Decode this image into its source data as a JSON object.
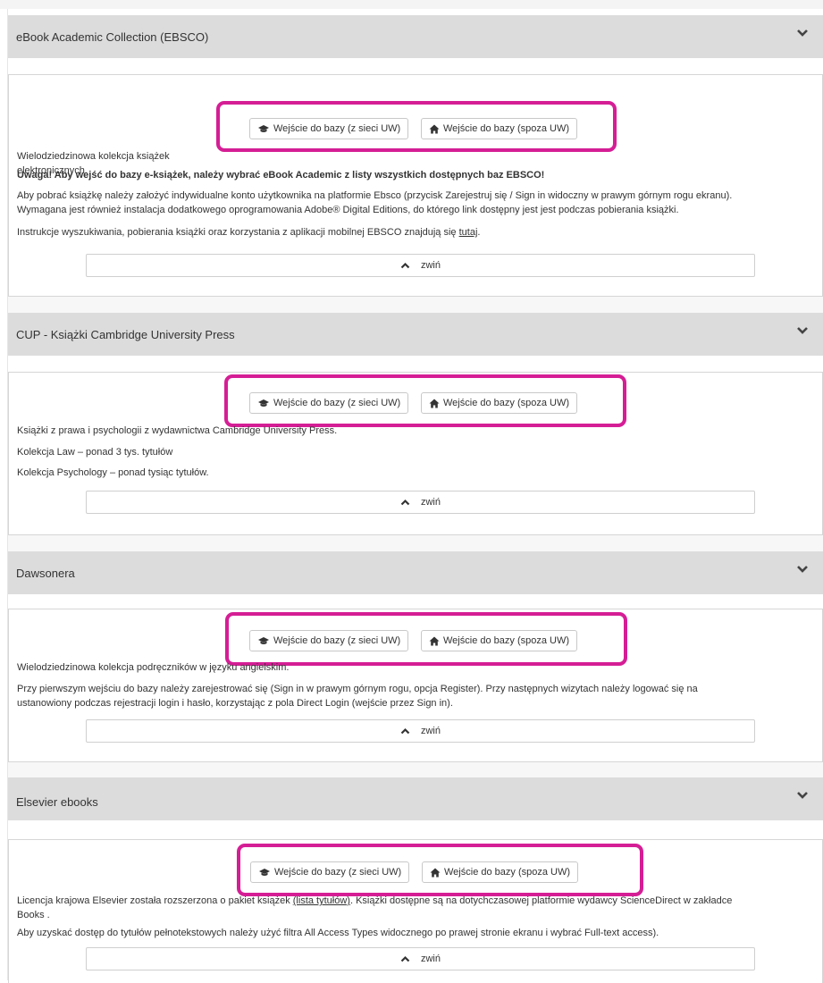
{
  "button_labels": {
    "in_network": "Wejście do bazy (z sieci UW)",
    "off_network": "Wejście do bazy (spoza UW)",
    "collapse": "zwiń"
  },
  "icons": {
    "in_network": "graduation-cap-icon",
    "off_network": "home-icon",
    "expand": "chevron-down-icon",
    "collapse": "chevron-up-icon"
  },
  "colors": {
    "highlight": "#d51e95",
    "header_bg": "#dcdcdc"
  },
  "panels": [
    {
      "title": "eBook Academic Collection (EBSCO)",
      "desc": "Wielodziedzinowa kolekcja książek elektronicznych.",
      "warning": "Uwaga! Aby wejść do bazy e-książek, należy wybrać eBook Academic z listy wszystkich dostępnych baz EBSCO!",
      "p1_line1": "Aby pobrać książkę należy założyć indywidualne konto użytkownika na platformie Ebsco (przycisk Zarejestruj się / Sign in widoczny w prawym górnym rogu ekranu).",
      "p1_line2": "Wymagana jest również instalacja dodatkowego oprogramowania Adobe® Digital Editions, do którego link dostępny jest jest podczas pobierania książki.",
      "p2": "Instrukcje wyszukiwania, pobierania książki oraz korzystania z aplikacji mobilnej EBSCO znajdują się",
      "p2_link": "tutaj",
      "p2_end": "."
    },
    {
      "title": "CUP - Książki Cambridge University Press",
      "desc": "Książki z prawa i psychologii z wydawnictwa Cambridge University Press.",
      "line1": "Kolekcja Law – ponad 3 tys. tytułów",
      "line2": "Kolekcja Psychology – ponad tysiąc tytułów."
    },
    {
      "title": "Dawsonera",
      "desc": "Wielodziedzinowa kolekcja podręczników w języku angielskim.",
      "p_line1": "Przy pierwszym wejściu do bazy należy zarejestrować się (Sign in w prawym górnym rogu, opcja Register). Przy następnych wizytach należy logować się na",
      "p_line2": "ustanowiony podczas rejestracji login i hasło, korzystając z pola Direct Login (wejście przez Sign in)."
    },
    {
      "title": "Elsevier ebooks",
      "p1_start": "Licencja krajowa Elsevier została rozszerzona o pakiet książek",
      "p1_link": "(lista tytułów)",
      "p1_rest": ". Książki dostępne są na dotychczasowej platformie wydawcy ScienceDirect w zakładce",
      "p1_line2": "Books .",
      "p2": "Aby uzyskać dostęp do tytułów pełnotekstowych należy użyć filtra All Access Types widocznego po prawej stronie ekranu i wybrać Full-text access)."
    }
  ]
}
